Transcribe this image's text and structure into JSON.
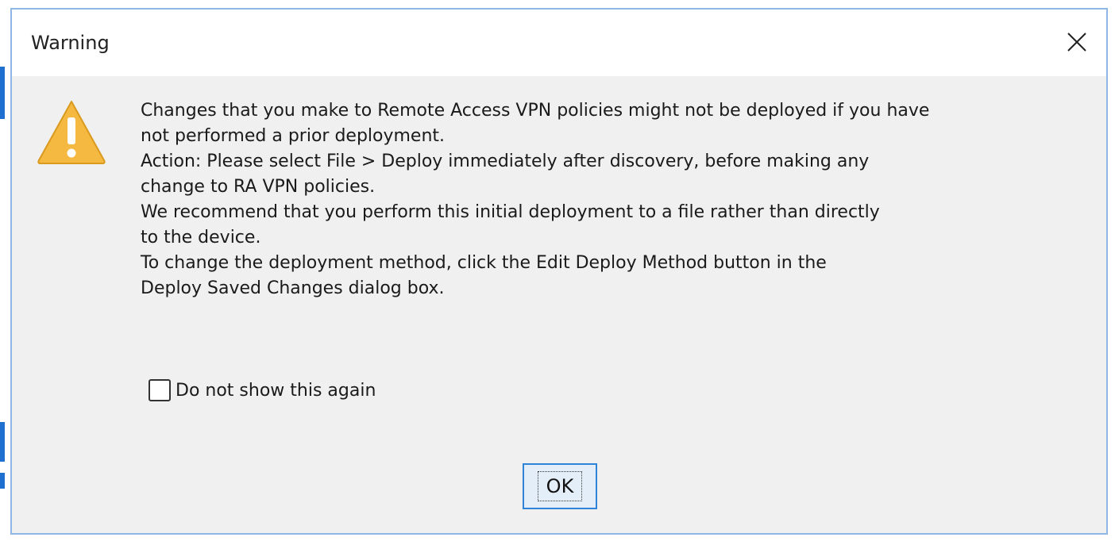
{
  "dialog": {
    "title": "Warning",
    "close_icon": "close-icon",
    "warning_icon": "warning-triangle-icon",
    "message_lines": [
      "Changes that you make to Remote Access VPN policies might not be deployed if you have",
      "not performed a prior deployment.",
      "Action: Please select File > Deploy immediately after discovery, before making any",
      "change to RA VPN policies.",
      "We recommend that you perform this initial deployment to a file rather than directly",
      "to the device.",
      "To change the deployment method, click the Edit Deploy Method button in the",
      "Deploy Saved Changes dialog box."
    ],
    "checkbox": {
      "label": "Do not show this again",
      "checked": false
    },
    "ok_label": "OK"
  },
  "colors": {
    "dialog_border": "#8fb7e3",
    "dialog_body": "#f0f0f0",
    "warning_fill": "#f5b840",
    "button_border": "#2f84d8"
  }
}
